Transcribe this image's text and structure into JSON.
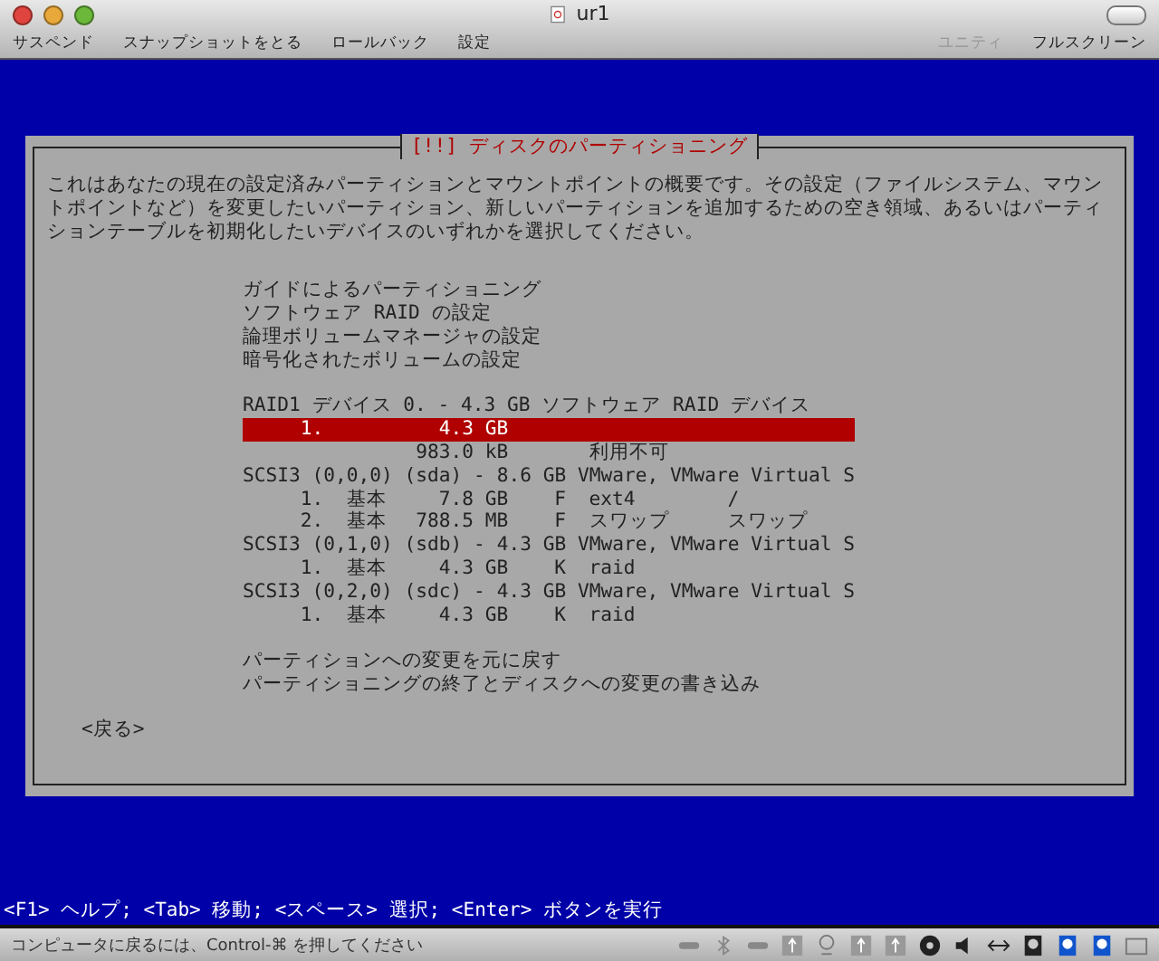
{
  "window": {
    "title": "ur1"
  },
  "toolbar": {
    "left": [
      {
        "label": "サスペンド",
        "disabled": false
      },
      {
        "label": "スナップショットをとる",
        "disabled": false
      },
      {
        "label": "ロールバック",
        "disabled": false
      },
      {
        "label": "設定",
        "disabled": false
      }
    ],
    "right": [
      {
        "label": "ユニティ",
        "disabled": true
      },
      {
        "label": "フルスクリーン",
        "disabled": false
      }
    ]
  },
  "dialog": {
    "title": "[!!] ディスクのパーティショニング",
    "description": "これはあなたの現在の設定済みパーティションとマウントポイントの概要です。その設定（ファイルシステム、マウントポイントなど）を変更したいパーティション、新しいパーティションを追加するための空き領域、あるいはパーティションテーブルを初期化したいデバイスのいずれかを選択してください。",
    "menu": [
      {
        "label": "ガイドによるパーティショニング",
        "selected": false
      },
      {
        "label": "ソフトウェア RAID の設定",
        "selected": false
      },
      {
        "label": "論理ボリュームマネージャの設定",
        "selected": false
      },
      {
        "label": "暗号化されたボリュームの設定",
        "selected": false
      }
    ],
    "devices": [
      {
        "kind": "disk",
        "label": "RAID1 デバイス 0. - 4.3 GB ソフトウェア RAID デバイス",
        "selected": false
      },
      {
        "kind": "partition",
        "number": "1.",
        "size": "4.3 GB",
        "selected": true
      },
      {
        "kind": "partition",
        "size": "983.0 kB",
        "fs": "利用不可",
        "selected": false
      },
      {
        "kind": "disk",
        "label": "SCSI3 (0,0,0) (sda) - 8.6 GB VMware, VMware Virtual S",
        "selected": false
      },
      {
        "kind": "partition",
        "number": "1.",
        "type": "基本",
        "size": "7.8 GB",
        "flag": "F",
        "fs": "ext4",
        "mount": "/",
        "selected": false
      },
      {
        "kind": "partition",
        "number": "2.",
        "type": "基本",
        "size": "788.5 MB",
        "flag": "F",
        "fs": "スワップ",
        "mount": "スワップ",
        "selected": false
      },
      {
        "kind": "disk",
        "label": "SCSI3 (0,1,0) (sdb) - 4.3 GB VMware, VMware Virtual S",
        "selected": false
      },
      {
        "kind": "partition",
        "number": "1.",
        "type": "基本",
        "size": "4.3 GB",
        "flag": "K",
        "fs": "raid",
        "selected": false
      },
      {
        "kind": "disk",
        "label": "SCSI3 (0,2,0) (sdc) - 4.3 GB VMware, VMware Virtual S",
        "selected": false
      },
      {
        "kind": "partition",
        "number": "1.",
        "type": "基本",
        "size": "4.3 GB",
        "flag": "K",
        "fs": "raid",
        "selected": false
      }
    ],
    "actions": [
      {
        "label": "パーティションへの変更を元に戻す",
        "selected": false
      },
      {
        "label": "パーティショニングの終了とディスクへの変更の書き込み",
        "selected": false
      }
    ],
    "back_button": "<戻る>"
  },
  "help_line": "<F1> ヘルプ; <Tab> 移動; <スペース> 選択; <Enter> ボタンを実行",
  "status_bar": {
    "message": "コンピュータに戻るには、Control-⌘ を押してください"
  }
}
